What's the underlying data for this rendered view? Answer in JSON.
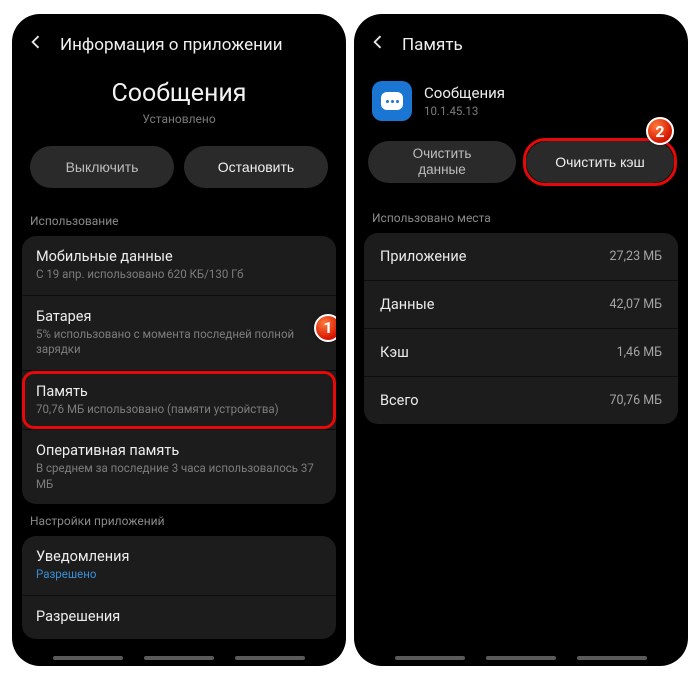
{
  "left": {
    "header": "Информация о приложении",
    "appName": "Сообщения",
    "status": "Установлено",
    "buttons": {
      "disable": "Выключить",
      "stop": "Остановить"
    },
    "usageLabel": "Использование",
    "items": {
      "mobileData": {
        "title": "Мобильные данные",
        "sub": "С 19 апр. использовано 620 КБ/130 Гб"
      },
      "battery": {
        "title": "Батарея",
        "sub": "5% использовано с момента последней полной зарядки"
      },
      "memory": {
        "title": "Память",
        "sub": "70,76 МБ использовано (памяти устройства)"
      },
      "ram": {
        "title": "Оперативная память",
        "sub": "В среднем за последние 3 часа использовалось 37 МБ"
      }
    },
    "appSettingsLabel": "Настройки приложений",
    "notifications": {
      "title": "Уведомления",
      "sub": "Разрешено"
    },
    "permissions": {
      "title": "Разрешения"
    }
  },
  "right": {
    "header": "Память",
    "appName": "Сообщения",
    "version": "10.1.45.13",
    "buttons": {
      "clearData": "Очистить данные",
      "clearCache": "Очистить кэш"
    },
    "usedLabel": "Использовано места",
    "rows": {
      "app": {
        "key": "Приложение",
        "val": "27,23 МБ"
      },
      "data": {
        "key": "Данные",
        "val": "42,07 МБ"
      },
      "cache": {
        "key": "Кэш",
        "val": "1,46 МБ"
      },
      "total": {
        "key": "Всего",
        "val": "70,76 МБ"
      }
    }
  },
  "badges": {
    "one": "1",
    "two": "2"
  }
}
